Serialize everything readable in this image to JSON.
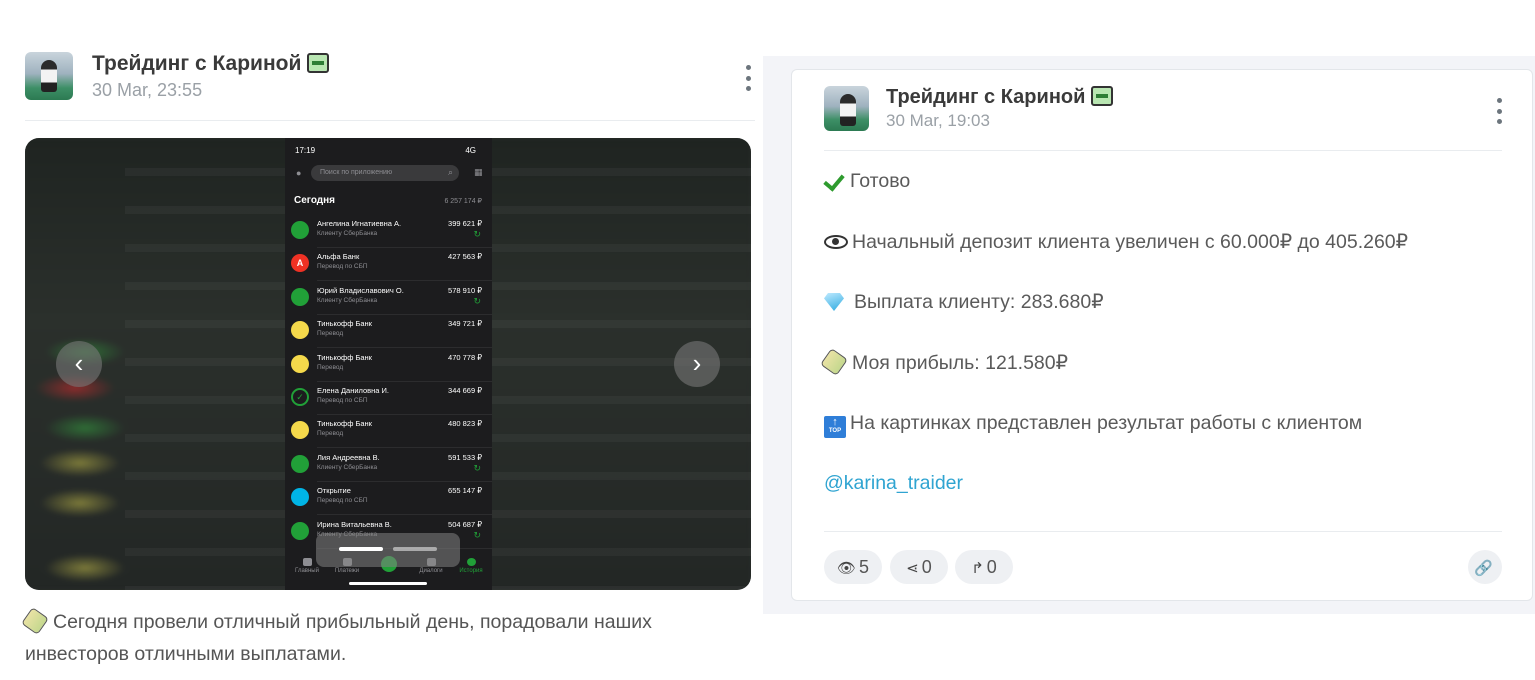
{
  "left_post": {
    "channel_name": "Трейдинг с Кариной",
    "date": "30 Mar, 23:55",
    "caption": "Сегодня провели отличный прибыльный день, порадовали наших инвесторов отличными выплатами.",
    "screenshot": {
      "status_time": "17:19",
      "status_signal": "4G",
      "search_placeholder": "Поиск по приложению",
      "section_title": "Сегодня",
      "section_total": "6 257 174 ₽",
      "transactions": [
        {
          "name": "Ангелина Игнатиевна А.",
          "sub": "Клиенту СберБанка",
          "amount": "399 621 ₽",
          "icon": "sber-icon",
          "color": "#21a038",
          "letter": "",
          "refresh": true
        },
        {
          "name": "Альфа Банк",
          "sub": "Перевод по СБП",
          "amount": "427 563 ₽",
          "icon": "alfa-icon",
          "color": "#ef3124",
          "letter": "A",
          "refresh": false
        },
        {
          "name": "Юрий Владиславович О.",
          "sub": "Клиенту СберБанка",
          "amount": "578 910 ₽",
          "icon": "sber-icon",
          "color": "#21a038",
          "letter": "",
          "refresh": true
        },
        {
          "name": "Тинькофф Банк",
          "sub": "Перевод",
          "amount": "349 721 ₽",
          "icon": "tinkoff-icon",
          "color": "#f5d94b",
          "letter": "",
          "refresh": false
        },
        {
          "name": "Тинькофф Банк",
          "sub": "Перевод",
          "amount": "470 778 ₽",
          "icon": "tinkoff-icon",
          "color": "#f5d94b",
          "letter": "",
          "refresh": false
        },
        {
          "name": "Елена Даниловна И.",
          "sub": "Перевод по СБП",
          "amount": "344 669 ₽",
          "icon": "check-circle-icon",
          "color": "#1c1c1e",
          "letter": "✓",
          "refresh": false
        },
        {
          "name": "Тинькофф Банк",
          "sub": "Перевод",
          "amount": "480 823 ₽",
          "icon": "tinkoff-icon",
          "color": "#f5d94b",
          "letter": "",
          "refresh": false
        },
        {
          "name": "Лия Андреевна В.",
          "sub": "Клиенту СберБанка",
          "amount": "591 533 ₽",
          "icon": "sber-icon",
          "color": "#21a038",
          "letter": "",
          "refresh": true
        },
        {
          "name": "Открытие",
          "sub": "Перевод по СБП",
          "amount": "655 147 ₽",
          "icon": "otkritie-icon",
          "color": "#00b4e6",
          "letter": "",
          "refresh": false
        },
        {
          "name": "Ирина Витальевна В.",
          "sub": "Клиенту СберБанка",
          "amount": "504 687 ₽",
          "icon": "sber-icon",
          "color": "#21a038",
          "letter": "",
          "refresh": true
        }
      ],
      "tabs": [
        "Главный",
        "Платежи",
        "",
        "Диалоги",
        "История"
      ]
    }
  },
  "right_post": {
    "channel_name": "Трейдинг с Кариной",
    "date": "30 Mar, 19:03",
    "lines": {
      "done": "Готово",
      "deposit": "Начальный депозит клиента увеличен с 60.000₽ до 405.260₽",
      "payout": "Выплата клиенту: 283.680₽",
      "profit": "Моя прибыль: 121.580₽",
      "pictures": "На картинках представлен результат работы с клиентом"
    },
    "handle": "@karina_traider",
    "top_badge": "TOP",
    "stats": {
      "views": "5",
      "shares": "0",
      "forwards": "0"
    }
  }
}
